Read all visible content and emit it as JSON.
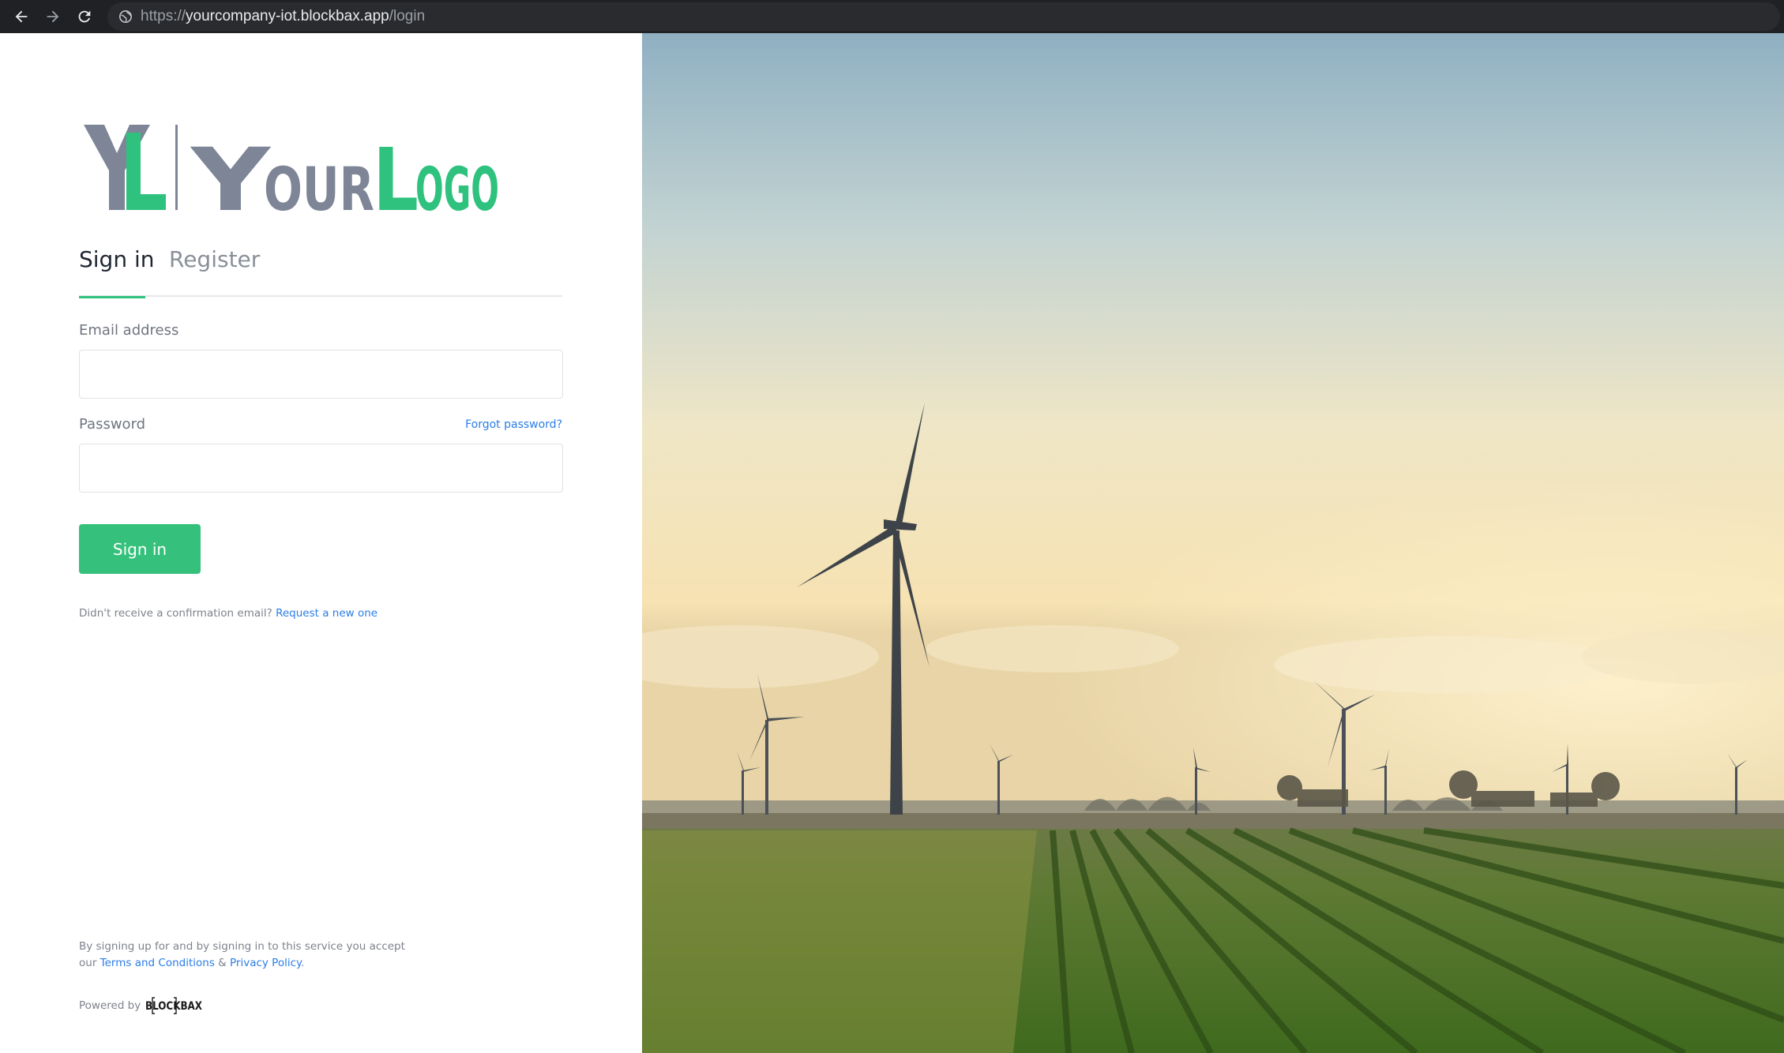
{
  "browser": {
    "url_scheme": "https://",
    "url_host": "yourcompany-iot.blockbax.app",
    "url_path": "/login"
  },
  "brand": {
    "logo_monogram": "YL",
    "logo_word_1": "YOUR",
    "logo_word_2": "LOGO",
    "gray": "#7d8597",
    "green": "#2ec27e"
  },
  "tabs": [
    {
      "label": "Sign in",
      "active": true
    },
    {
      "label": "Register",
      "active": false
    }
  ],
  "form": {
    "email_label": "Email address",
    "email_value": "",
    "password_label": "Password",
    "password_value": "",
    "forgot_label": "Forgot password?",
    "submit_label": "Sign in"
  },
  "confirm": {
    "text": "Didn't receive a confirmation email?",
    "link": "Request a new one"
  },
  "legal": {
    "line_1": "By signing up for and by signing in to this service you accept",
    "prefix": "our",
    "terms": "Terms and Conditions",
    "amp": "&",
    "privacy": "Privacy Policy",
    "suffix": "."
  },
  "powered": {
    "label": "Powered by",
    "brand": "BLOCKBAX"
  },
  "colors": {
    "accent": "#35c17b",
    "link": "#2b7de9"
  },
  "icons": [
    "back-arrow-icon",
    "forward-arrow-icon",
    "reload-icon",
    "site-info-icon"
  ]
}
